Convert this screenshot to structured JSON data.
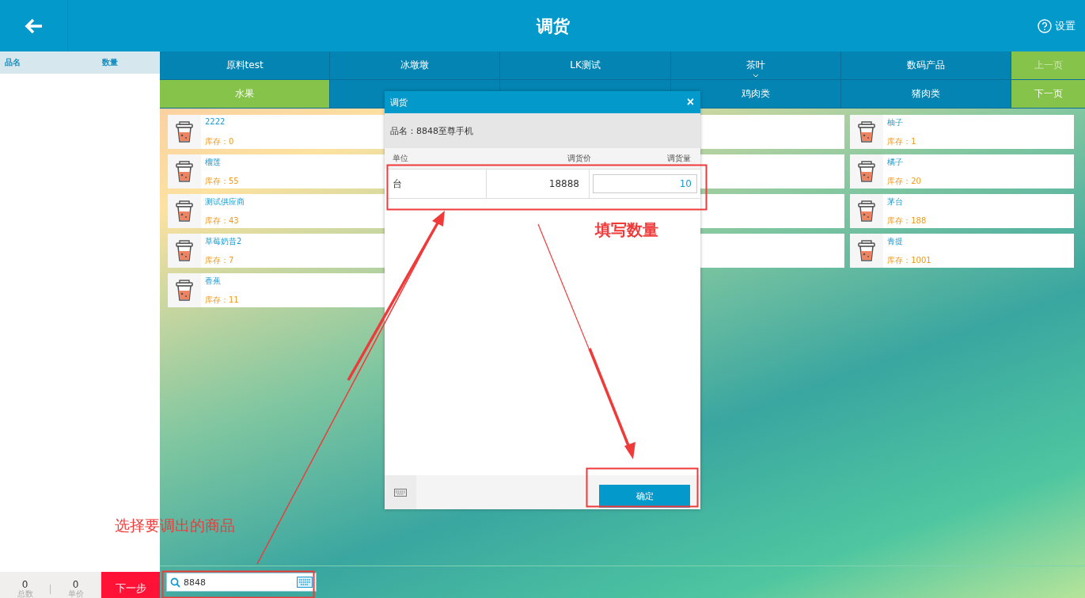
{
  "header": {
    "title": "调货",
    "settings": "设置"
  },
  "cart": {
    "columns": [
      "品名",
      "数量"
    ],
    "totals": [
      {
        "value": "0",
        "label": "总数"
      },
      {
        "value": "0",
        "label": "单价"
      }
    ],
    "next_button": "下一步"
  },
  "category_rows": [
    [
      {
        "label": "原料test",
        "selected": false
      },
      {
        "label": "冰墩墩",
        "selected": false
      },
      {
        "label": "LK测试",
        "selected": false
      },
      {
        "label": "茶叶",
        "selected": false,
        "has_more": true
      },
      {
        "label": "数码产品",
        "selected": false
      }
    ],
    [
      {
        "label": "水果",
        "selected": true
      },
      {
        "selected": false
      },
      {
        "selected": false
      },
      {
        "label": "鸡肉类",
        "selected": false
      },
      {
        "label": "猪肉类",
        "selected": false
      }
    ]
  ],
  "pager": [
    {
      "label": "上一页",
      "disabled": true
    },
    {
      "label": "下一页",
      "disabled": false
    }
  ],
  "product_columns": [
    [
      {
        "kind": "product",
        "name": "2222",
        "stock": "库存：0"
      },
      {
        "kind": "product",
        "name": "榴莲",
        "stock": "库存：55"
      },
      {
        "kind": "product",
        "name": "测试供应商",
        "stock": "库存：43"
      },
      {
        "kind": "product",
        "name": "草莓奶昔2",
        "stock": "库存：7"
      },
      {
        "kind": "product",
        "name": "香蕉",
        "stock": "库存：11"
      }
    ],
    [
      {
        "kind": "covered"
      },
      {
        "kind": "covered"
      },
      {
        "kind": "covered"
      },
      {
        "kind": "covered"
      }
    ],
    [
      {
        "kind": "product",
        "name": "柚子",
        "stock": "库存：1"
      },
      {
        "kind": "product",
        "name": "橘子",
        "stock": "库存：20"
      },
      {
        "kind": "product",
        "name": "茅台",
        "stock": "库存：188"
      },
      {
        "kind": "product",
        "name": "青提",
        "stock": "库存：1001"
      }
    ]
  ],
  "search": {
    "value": "8848"
  },
  "dialog": {
    "title": "调货",
    "close": "×",
    "product": "品名：8848至尊手机",
    "columns": [
      "单位",
      "调货价",
      "调货量"
    ],
    "row": {
      "unit": "台",
      "price": "18888",
      "quantity": "10"
    },
    "confirm": "确定"
  },
  "annotations": [
    {
      "text": "选择要调出的商品"
    },
    {
      "text": "填写数量"
    }
  ]
}
